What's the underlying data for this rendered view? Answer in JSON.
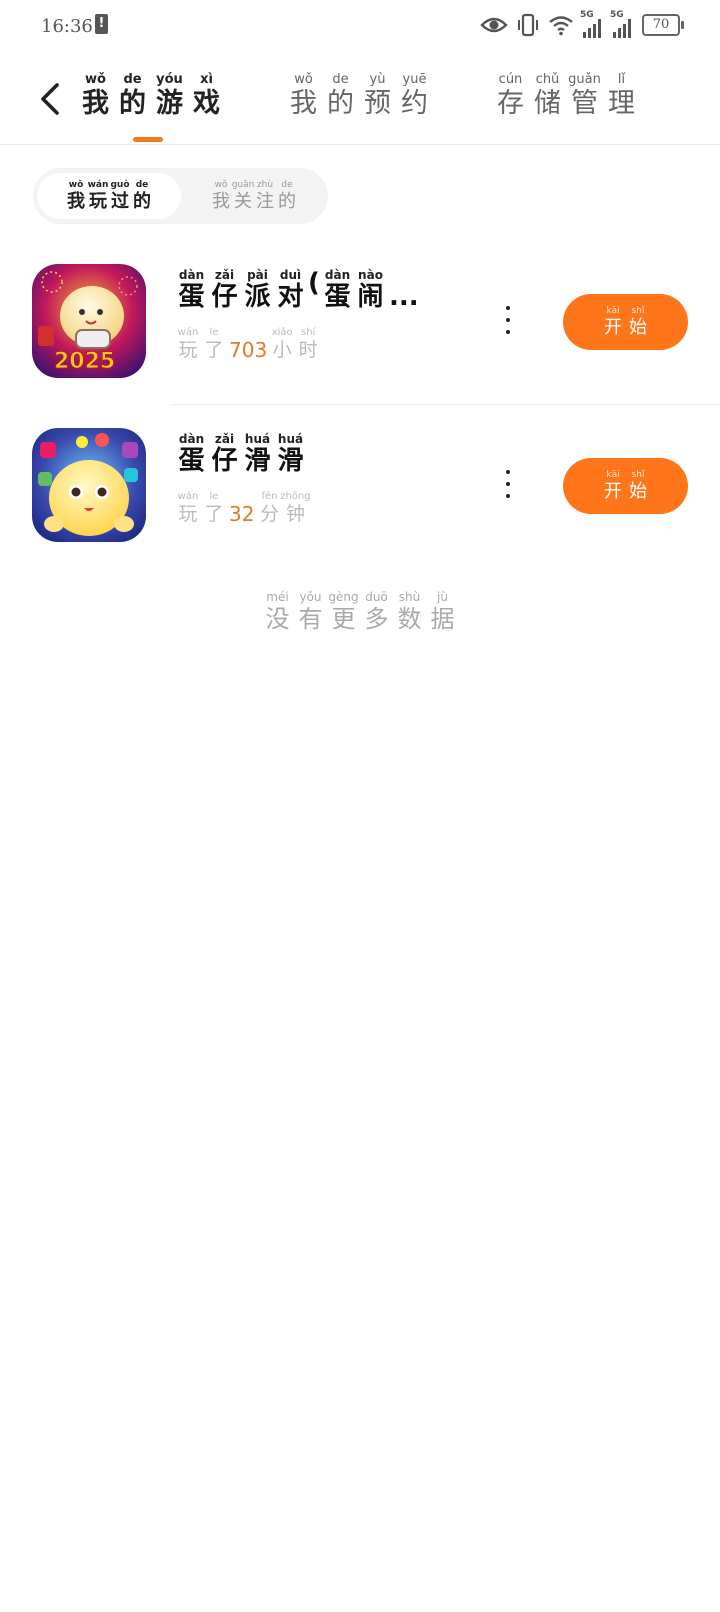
{
  "status_bar": {
    "time": "16:36",
    "alert": "!",
    "battery": "70",
    "network_1": "5G",
    "network_2": "5G"
  },
  "header": {
    "tabs": [
      {
        "chars": [
          {
            "py": "wǒ",
            "hz": "我"
          },
          {
            "py": "de",
            "hz": "的"
          },
          {
            "py": "yóu",
            "hz": "游"
          },
          {
            "py": "xì",
            "hz": "戏"
          }
        ],
        "active": true
      },
      {
        "chars": [
          {
            "py": "wǒ",
            "hz": "我"
          },
          {
            "py": "de",
            "hz": "的"
          },
          {
            "py": "yù",
            "hz": "预"
          },
          {
            "py": "yuē",
            "hz": "约"
          }
        ],
        "active": false
      },
      {
        "chars": [
          {
            "py": "cún",
            "hz": "存"
          },
          {
            "py": "chǔ",
            "hz": "储"
          },
          {
            "py": "guǎn",
            "hz": "管"
          },
          {
            "py": "lǐ",
            "hz": "理"
          }
        ],
        "active": false
      }
    ],
    "accent_color": "#ef7b1e"
  },
  "segment": {
    "items": [
      {
        "chars": [
          {
            "py": "wǒ",
            "hz": "我"
          },
          {
            "py": "wán",
            "hz": "玩"
          },
          {
            "py": "guò",
            "hz": "过"
          },
          {
            "py": "de",
            "hz": "的"
          }
        ],
        "selected": true
      },
      {
        "chars": [
          {
            "py": "wǒ",
            "hz": "我"
          },
          {
            "py": "guān",
            "hz": "关"
          },
          {
            "py": "zhù",
            "hz": "注"
          },
          {
            "py": "de",
            "hz": "的"
          }
        ],
        "selected": false
      }
    ]
  },
  "games": [
    {
      "title_chars": [
        {
          "py": "dàn",
          "hz": "蛋"
        },
        {
          "py": "zǎi",
          "hz": "仔"
        },
        {
          "py": "pài",
          "hz": "派"
        },
        {
          "py": "duì",
          "hz": "对"
        },
        {
          "py": "",
          "hz": "("
        },
        {
          "py": "dàn",
          "hz": "蛋"
        },
        {
          "py": "nào",
          "hz": "闹"
        }
      ],
      "title_ellipsis": "...",
      "play_prefix": [
        {
          "py": "wán",
          "hz": "玩"
        },
        {
          "py": "le",
          "hz": "了"
        }
      ],
      "play_value": "703",
      "play_unit": [
        {
          "py": "xiǎo",
          "hz": "小"
        },
        {
          "py": "shí",
          "hz": "时"
        }
      ],
      "icon": "egg-party-2025-icon",
      "button": [
        {
          "py": "kāi",
          "hz": "开"
        },
        {
          "py": "shǐ",
          "hz": "始"
        }
      ]
    },
    {
      "title_chars": [
        {
          "py": "dàn",
          "hz": "蛋"
        },
        {
          "py": "zǎi",
          "hz": "仔"
        },
        {
          "py": "huá",
          "hz": "滑"
        },
        {
          "py": "huá",
          "hz": "滑"
        }
      ],
      "title_ellipsis": "",
      "play_prefix": [
        {
          "py": "wán",
          "hz": "玩"
        },
        {
          "py": "le",
          "hz": "了"
        }
      ],
      "play_value": "32",
      "play_unit": [
        {
          "py": "fēn",
          "hz": "分"
        },
        {
          "py": "zhōng",
          "hz": "钟"
        }
      ],
      "icon": "egg-slide-icon",
      "button": [
        {
          "py": "kāi",
          "hz": "开"
        },
        {
          "py": "shǐ",
          "hz": "始"
        }
      ]
    }
  ],
  "footer": {
    "no_more_chars": [
      {
        "py": "méi",
        "hz": "没"
      },
      {
        "py": "yǒu",
        "hz": "有"
      },
      {
        "py": "gèng",
        "hz": "更"
      },
      {
        "py": "duō",
        "hz": "多"
      },
      {
        "py": "shù",
        "hz": "数"
      },
      {
        "py": "jù",
        "hz": "据"
      }
    ]
  },
  "colors": {
    "button_orange": "#ff7519",
    "play_value_orange": "#e07a28"
  }
}
